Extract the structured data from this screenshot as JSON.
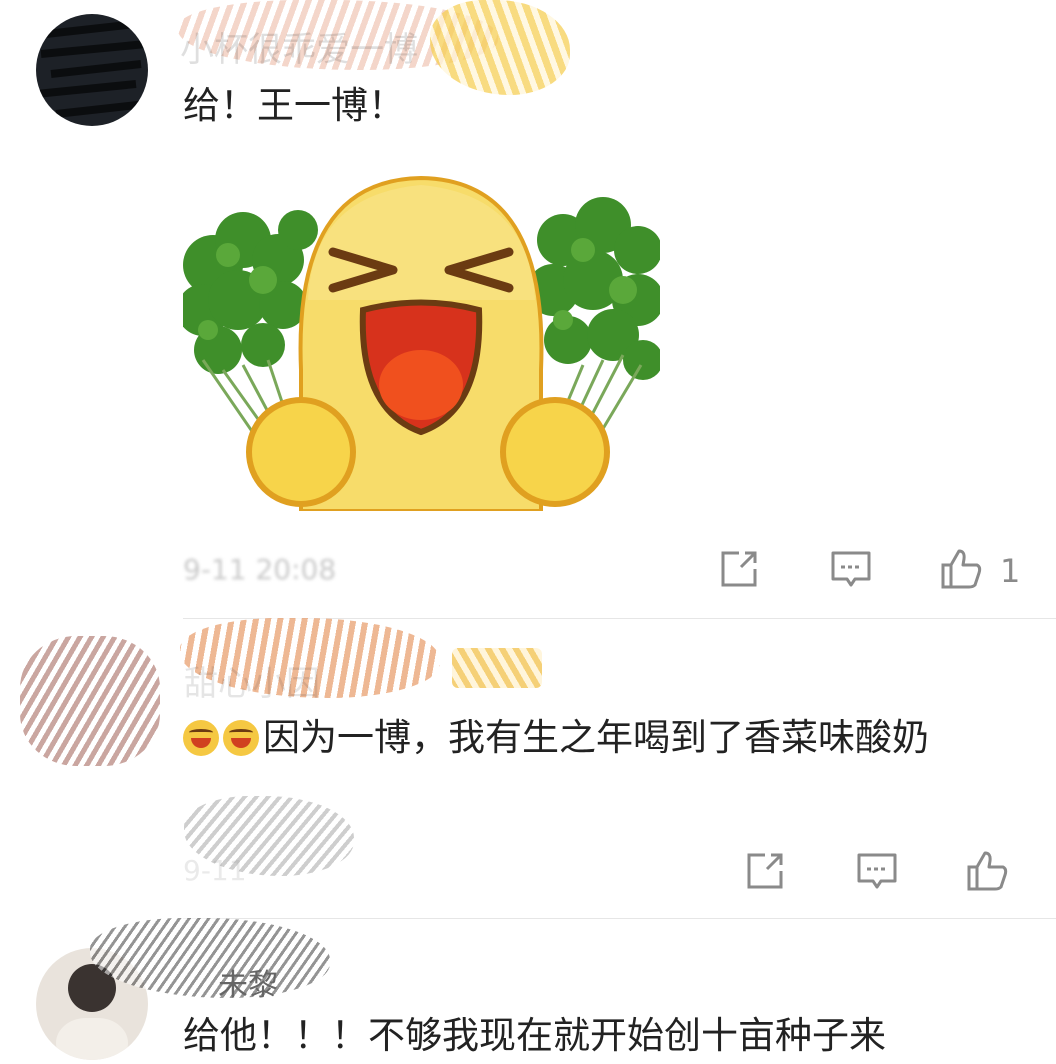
{
  "comments": [
    {
      "username": "小杯很乖爱一博",
      "text": "给！王一博！",
      "time": "9-11 20:08",
      "likes": "1"
    },
    {
      "username": "甜心小因",
      "emoji_prefix": "laugh-cry-emoji",
      "text": "因为一博，我有生之年喝到了香菜味酸奶",
      "time": "9-11",
      "likes": ""
    },
    {
      "username": "未黎",
      "text": "给他！！！不够我现在就开始创十亩种子来"
    }
  ],
  "colors": {
    "text": "#222222",
    "meta": "#c9c9c9",
    "icon": "#8a8a8a",
    "emoji_yellow": "#f7d44a",
    "emoji_outline": "#e0a020",
    "cilantro": "#3f8f2a"
  }
}
